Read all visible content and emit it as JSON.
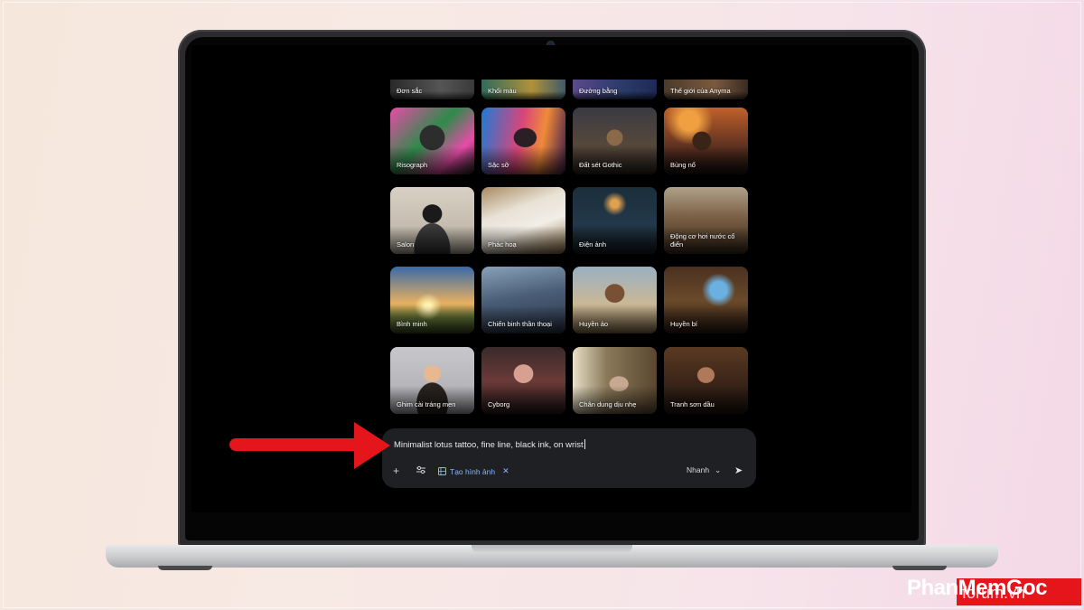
{
  "style_tiles_partial": [
    {
      "label": "Đơn sắc"
    },
    {
      "label": "Khối màu"
    },
    {
      "label": "Đường bằng"
    },
    {
      "label": "Thế giới của Anyma"
    }
  ],
  "style_tiles": [
    {
      "label": "Risograph"
    },
    {
      "label": "Sặc sỡ"
    },
    {
      "label": "Đất sét Gothic"
    },
    {
      "label": "Bùng nổ"
    },
    {
      "label": "Salon"
    },
    {
      "label": "Phác hoạ"
    },
    {
      "label": "Điện ảnh"
    },
    {
      "label": "Động cơ hơi nước cổ điển"
    },
    {
      "label": "Bình minh"
    },
    {
      "label": "Chiến binh thần thoại"
    },
    {
      "label": "Huyền ảo"
    },
    {
      "label": "Huyền bí"
    },
    {
      "label": "Ghim cài tráng men"
    },
    {
      "label": "Cyborg"
    },
    {
      "label": "Chân dung dịu nhẹ"
    },
    {
      "label": "Tranh sơn dầu"
    }
  ],
  "prompt": {
    "text": "Minimalist lotus tattoo, fine line, black ink, on wrist",
    "add_icon": "plus-icon",
    "tools_icon": "sliders-icon",
    "tool_chip_label": "Tạo hình ảnh",
    "tool_chip_icon": "image-grid-icon",
    "remove_icon": "close-icon",
    "model_label": "Nhanh",
    "send_icon": "send-icon"
  },
  "watermark": {
    "text": "PhanMemGoc",
    "sub": "forum.vn"
  },
  "colors": {
    "accent_red": "#e4161c",
    "chip_blue": "#8ab4f8",
    "prompt_bg": "#1f2023"
  }
}
